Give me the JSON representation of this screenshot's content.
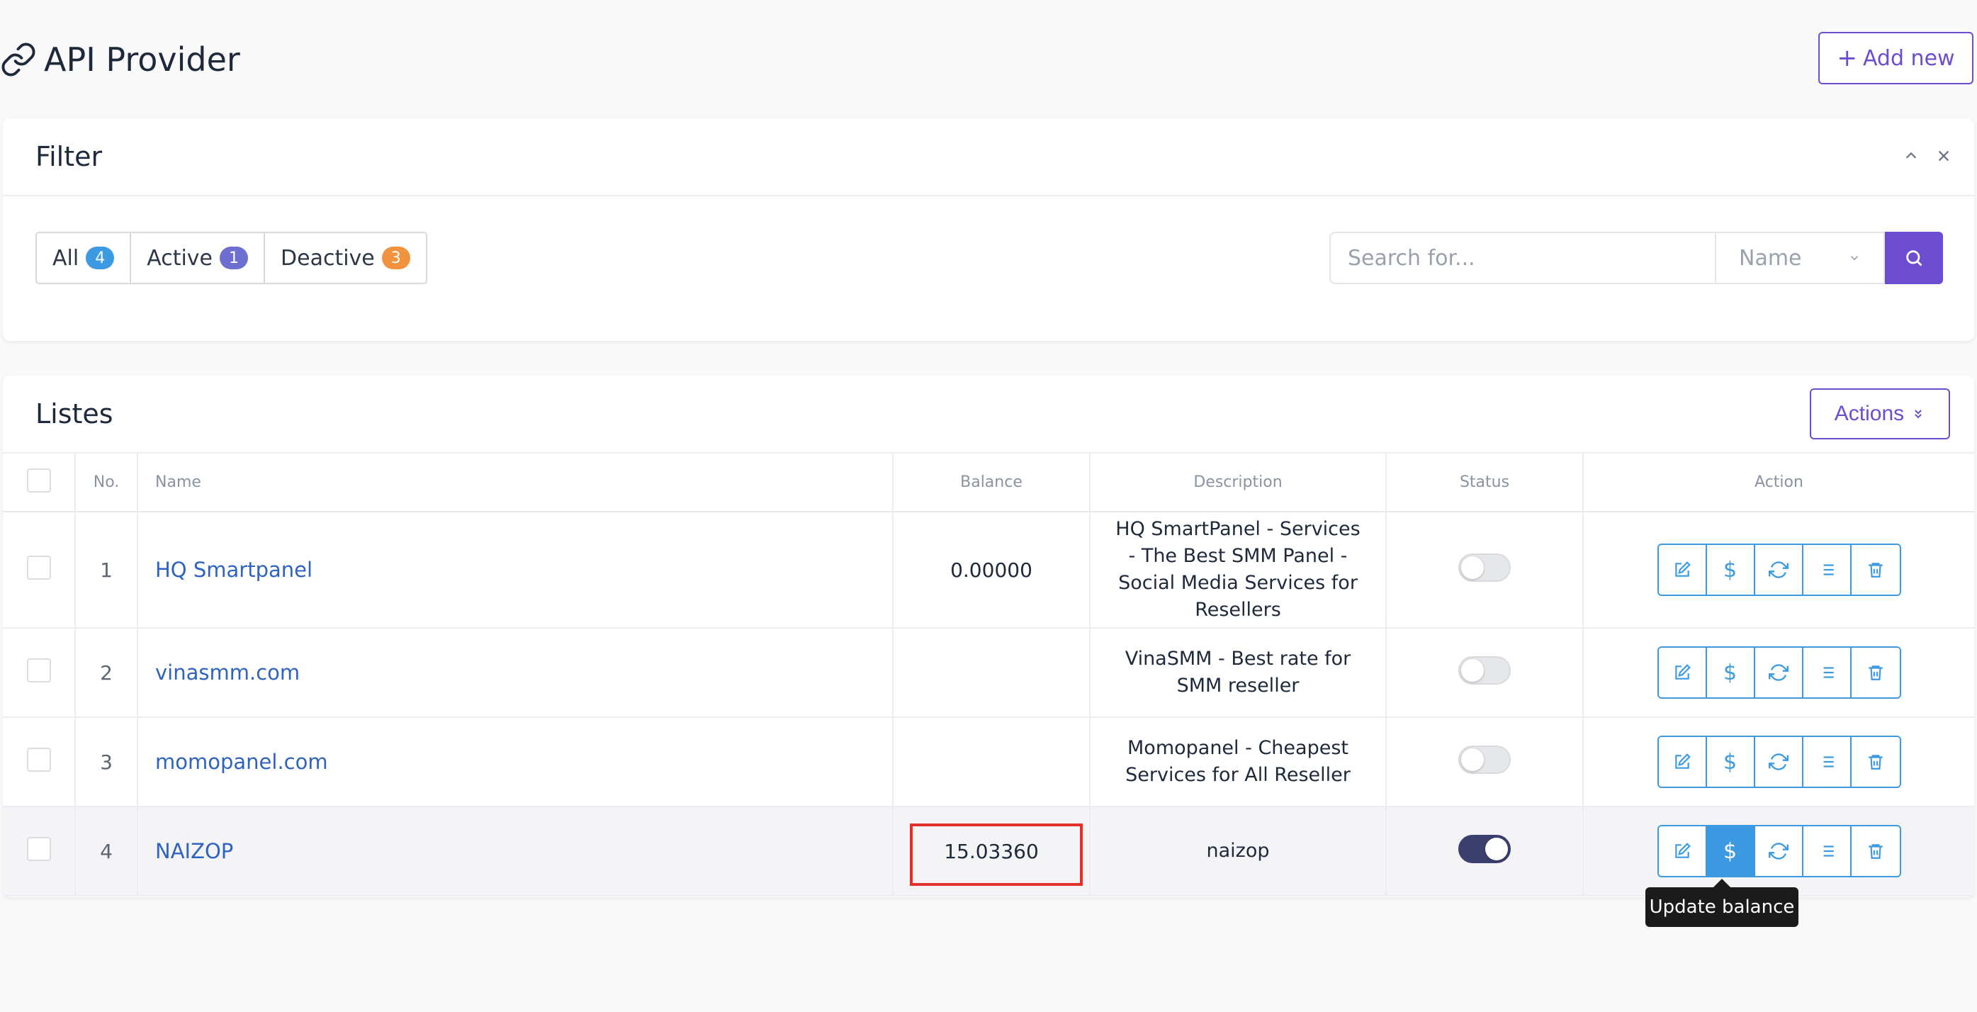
{
  "page": {
    "title": "API Provider",
    "add_new_label": "Add new"
  },
  "filter": {
    "title": "Filter",
    "segments": [
      {
        "label": "All",
        "count": "4",
        "color": "#3b9ae1"
      },
      {
        "label": "Active",
        "count": "1",
        "color": "#6c6fcf"
      },
      {
        "label": "Deactive",
        "count": "3",
        "color": "#f0923e"
      }
    ],
    "search_placeholder": "Search for...",
    "search_field": "Name"
  },
  "list": {
    "title": "Listes",
    "actions_label": "Actions",
    "columns": {
      "no": "No.",
      "name": "Name",
      "balance": "Balance",
      "description": "Description",
      "status": "Status",
      "action": "Action"
    },
    "rows": [
      {
        "no": "1",
        "name": "HQ Smartpanel",
        "balance": "0.00000",
        "description": "HQ SmartPanel - Services - The Best SMM Panel - Social Media Services for Resellers",
        "status": false
      },
      {
        "no": "2",
        "name": "vinasmm.com",
        "balance": "",
        "description": "VinaSMM - Best rate for SMM reseller",
        "status": false
      },
      {
        "no": "3",
        "name": "momopanel.com",
        "balance": "",
        "description": "Momopanel - Cheapest Services for All Reseller",
        "status": false
      },
      {
        "no": "4",
        "name": "NAIZOP",
        "balance": "15.03360",
        "description": "naizop",
        "status": true
      }
    ]
  },
  "tooltip": {
    "text": "Update balance"
  },
  "colors": {
    "primary": "#6c4ccf",
    "info": "#3b9ae1",
    "link": "#2f63c0",
    "highlight": "#e2312d"
  }
}
